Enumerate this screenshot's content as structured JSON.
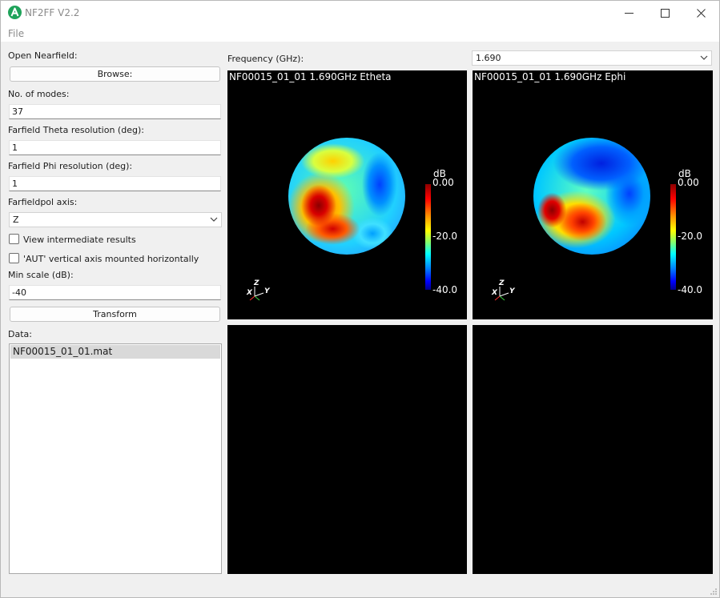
{
  "window": {
    "title": "NF2FF V2.2"
  },
  "menu": {
    "file": "File"
  },
  "left": {
    "open_nearfield_label": "Open Nearfield:",
    "browse_label": "Browse:",
    "modes_label": "No. of modes:",
    "modes_value": "37",
    "theta_label": "Farfield Theta resolution (deg):",
    "theta_value": "1",
    "phi_label": "Farfield Phi resolution (deg):",
    "phi_value": "1",
    "pol_axis_label": "Farfieldpol axis:",
    "pol_axis_value": "Z",
    "view_intermediate_label": "View intermediate results",
    "aut_label": "'AUT' vertical axis mounted horizontally",
    "min_scale_label": "Min scale (dB):",
    "min_scale_value": "-40",
    "transform_label": "Transform",
    "data_label": "Data:",
    "data_items": [
      "NF00015_01_01.mat"
    ]
  },
  "right": {
    "frequency_label": "Frequency (GHz):",
    "frequency_value": "1.690",
    "views": [
      {
        "title": "NF00015_01_01 1.690GHz  Etheta"
      },
      {
        "title": "NF00015_01_01 1.690GHz  Ephi"
      }
    ],
    "colorbar": {
      "unit": "dB",
      "ticks": [
        "0.00",
        "-20.0",
        "-40.0"
      ],
      "range": [
        -40,
        0
      ]
    },
    "axis_labels": {
      "z": "Z",
      "y": "Y",
      "x": "X"
    }
  },
  "icons": {
    "app": "app-logo-icon",
    "minimize": "minimize-icon",
    "maximize": "maximize-icon",
    "close": "close-icon",
    "chevron": "chevron-down-icon"
  }
}
